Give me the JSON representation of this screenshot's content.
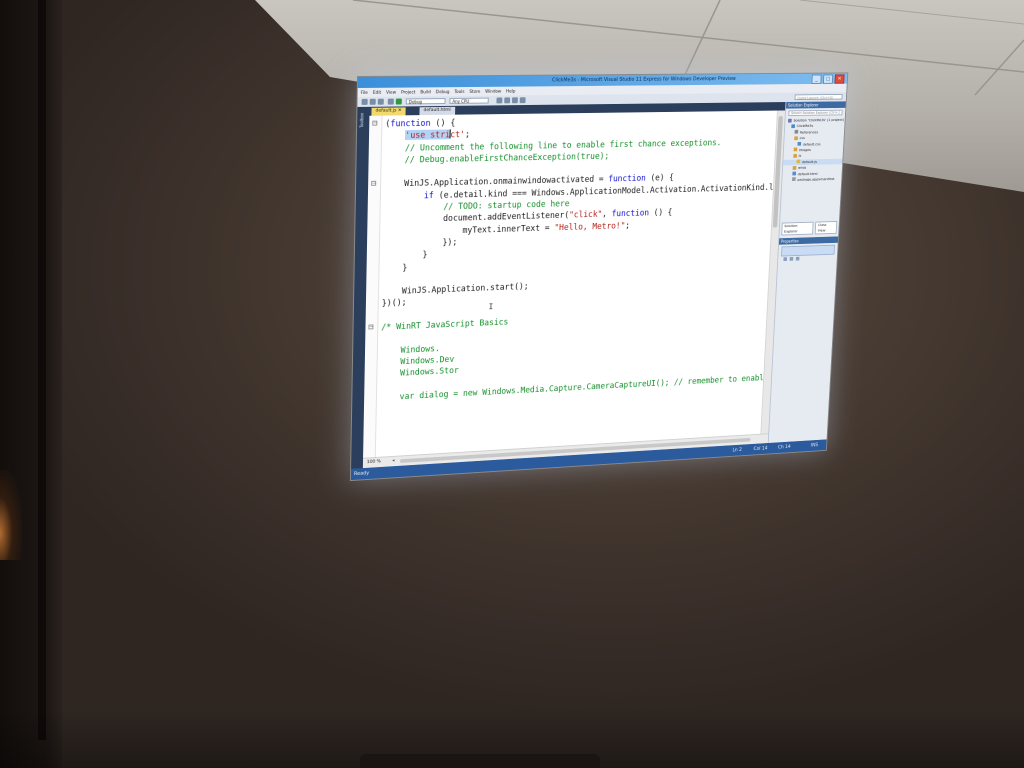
{
  "projected_screen": {
    "titlebar": {
      "title": "ClickMe3s - Microsoft Visual Studio 11 Express for Windows Developer Preview",
      "buttons": [
        "_",
        "□",
        "✕"
      ]
    },
    "menu": [
      "File",
      "Edit",
      "View",
      "Project",
      "Build",
      "Debug",
      "Tools",
      "Store",
      "Window",
      "Help"
    ],
    "toolbar": {
      "config_combo": "Debug",
      "platform_combo": "Any CPU",
      "quick_launch_placeholder": "Quick Launch (Ctrl+Q)",
      "icons": [
        "new-project-icon",
        "open-icon",
        "save-icon",
        "undo-icon",
        "redo-icon",
        "start-debug-icon"
      ]
    },
    "left_strip_label": "Toolbox",
    "tabs": [
      {
        "label": "default.js",
        "active": true,
        "close": "✕"
      },
      {
        "label": "default.html",
        "active": false
      }
    ],
    "editor": {
      "zoom": "100 %",
      "code_lines": [
        {
          "i": "",
          "parts": [
            {
              "t": "(",
              "c": ""
            },
            {
              "t": "function",
              "c": "kw"
            },
            {
              "t": " () {",
              "c": ""
            }
          ]
        },
        {
          "i": "    ",
          "parts": [
            {
              "t": "'use stri",
              "c": "st hl"
            },
            {
              "t": "",
              "c": "caret"
            },
            {
              "t": "ct'",
              "c": "st"
            },
            {
              "t": ";",
              "c": ""
            }
          ]
        },
        {
          "i": "    ",
          "parts": [
            {
              "t": "// Uncomment the following line to enable first chance exceptions.",
              "c": "cm"
            }
          ]
        },
        {
          "i": "    ",
          "parts": [
            {
              "t": "// Debug.enableFirstChanceException(true);",
              "c": "cm"
            }
          ]
        },
        {
          "i": "",
          "parts": []
        },
        {
          "i": "    ",
          "parts": [
            {
              "t": "WinJS.Application.onmainwindowactivated = ",
              "c": ""
            },
            {
              "t": "function",
              "c": "kw"
            },
            {
              "t": " (e) {",
              "c": ""
            }
          ]
        },
        {
          "i": "        ",
          "parts": [
            {
              "t": "if",
              "c": "kw"
            },
            {
              "t": " (e.detail.kind === Windows.ApplicationModel.Activation.ActivationKind.launch) {",
              "c": ""
            }
          ]
        },
        {
          "i": "            ",
          "parts": [
            {
              "t": "// TODO: startup code here",
              "c": "cm"
            }
          ]
        },
        {
          "i": "            ",
          "parts": [
            {
              "t": "document.addEventListener(",
              "c": ""
            },
            {
              "t": "\"click\"",
              "c": "st"
            },
            {
              "t": ", ",
              "c": ""
            },
            {
              "t": "function",
              "c": "kw"
            },
            {
              "t": " () {",
              "c": ""
            }
          ]
        },
        {
          "i": "                ",
          "parts": [
            {
              "t": "myText.innerText = ",
              "c": ""
            },
            {
              "t": "\"Hello, Metro!\"",
              "c": "st"
            },
            {
              "t": ";",
              "c": ""
            }
          ]
        },
        {
          "i": "            ",
          "parts": [
            {
              "t": "});",
              "c": ""
            }
          ]
        },
        {
          "i": "        ",
          "parts": [
            {
              "t": "}",
              "c": ""
            }
          ]
        },
        {
          "i": "    ",
          "parts": [
            {
              "t": "}",
              "c": ""
            }
          ]
        },
        {
          "i": "",
          "parts": []
        },
        {
          "i": "    ",
          "parts": [
            {
              "t": "WinJS.Application.start();",
              "c": ""
            }
          ]
        },
        {
          "i": "",
          "parts": [
            {
              "t": "})();",
              "c": ""
            }
          ]
        },
        {
          "i": "",
          "parts": []
        },
        {
          "i": "",
          "parts": [
            {
              "t": "/* WinRT JavaScript Basics",
              "c": "cm"
            }
          ]
        },
        {
          "i": "",
          "parts": []
        },
        {
          "i": "    ",
          "parts": [
            {
              "t": "Windows.",
              "c": "cm"
            }
          ]
        },
        {
          "i": "    ",
          "parts": [
            {
              "t": "Windows.Dev",
              "c": "cm"
            }
          ]
        },
        {
          "i": "    ",
          "parts": [
            {
              "t": "Windows.Stor",
              "c": "cm"
            }
          ]
        },
        {
          "i": "",
          "parts": []
        },
        {
          "i": "    ",
          "parts": [
            {
              "t": "var dialog = new Windows.Media.Capture.CameraCaptureUI(); // remember to enable web ca",
              "c": "cm"
            }
          ]
        }
      ]
    },
    "solution_explorer": {
      "title": "Solution Explorer",
      "search_placeholder": "Search Solution Explorer (Ctrl+;)",
      "items": [
        "Solution 'ClickMe3s' (1 project)",
        "ClickMe3s",
        "References",
        "css",
        "default.css",
        "images",
        "js",
        "default.js",
        "winjs",
        "default.html",
        "package.appxmanifest"
      ],
      "tabs": [
        "Solution Explorer",
        "Class View"
      ]
    },
    "properties": {
      "title": "Properties"
    },
    "status": {
      "ready": "Ready",
      "ln": "Ln 2",
      "col": "Col 14",
      "ch": "Ch 14",
      "ins": "INS"
    }
  }
}
